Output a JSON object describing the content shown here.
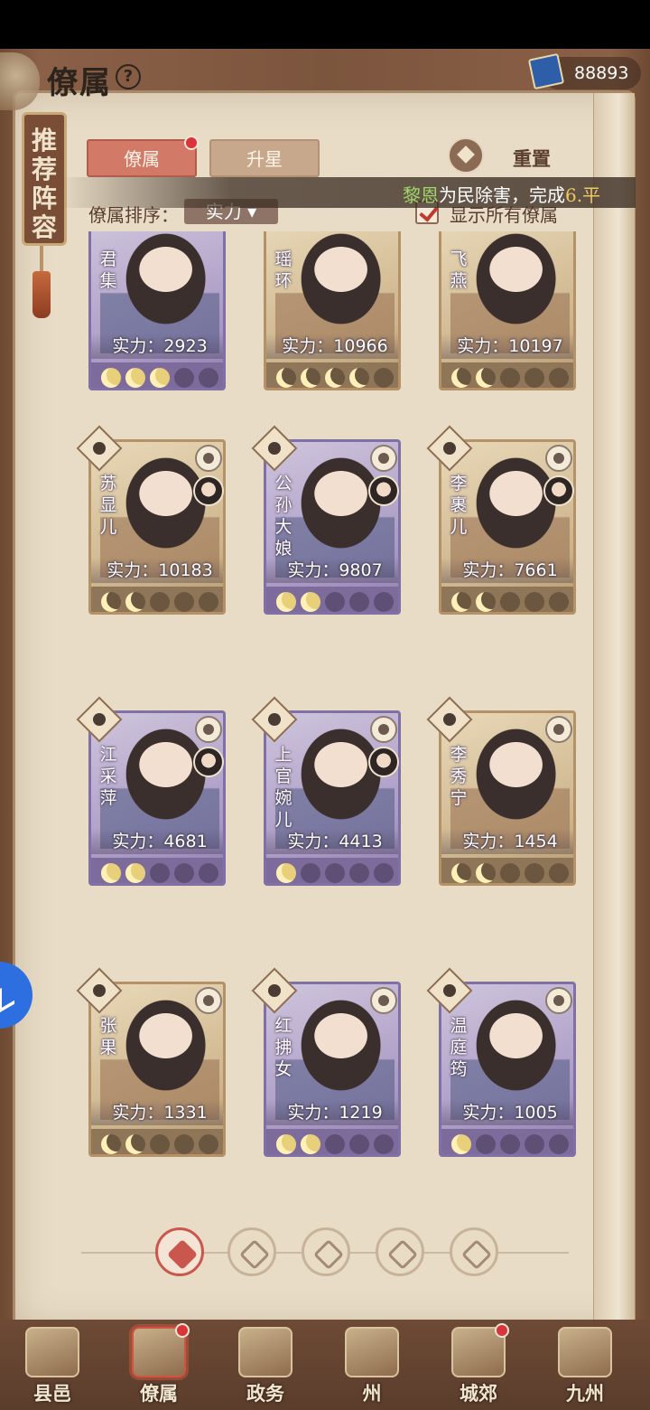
{
  "header": {
    "title": "僚属",
    "currency": {
      "icon": "book-scroll-icon",
      "value": "88893"
    }
  },
  "side_banner": {
    "label": "推荐阵容"
  },
  "tabs": [
    {
      "label": "僚属",
      "active": true,
      "badge": true
    },
    {
      "label": "升星",
      "active": false,
      "badge": false
    }
  ],
  "reset": {
    "label": "重置"
  },
  "announcement": {
    "name": "黎恩",
    "text": "为民除害，完成",
    "suffix": "6.平"
  },
  "sort": {
    "label": "僚属排序：",
    "value": "实力 ▾"
  },
  "show_all": {
    "label": "显示所有僚属",
    "checked": true
  },
  "cards": [
    {
      "name": "君集",
      "power": "实力：2923",
      "stars": 3,
      "theme": "purple"
    },
    {
      "name": "瑶环",
      "power": "实力：10966",
      "stars": 4,
      "theme": "gold"
    },
    {
      "name": "飞燕",
      "power": "实力：10197",
      "stars": 2,
      "theme": "gold"
    },
    {
      "name": "苏显儿",
      "power": "实力：10183",
      "stars": 2,
      "theme": "gold"
    },
    {
      "name": "公孙大娘",
      "power": "实力：9807",
      "stars": 2,
      "theme": "purple"
    },
    {
      "name": "李裹儿",
      "power": "实力：7661",
      "stars": 2,
      "theme": "gold"
    },
    {
      "name": "江采萍",
      "power": "实力：4681",
      "stars": 2,
      "theme": "purple"
    },
    {
      "name": "上官婉儿",
      "power": "实力：4413",
      "stars": 1,
      "theme": "purple"
    },
    {
      "name": "李秀宁",
      "power": "实力：1454",
      "stars": 2,
      "theme": "gold"
    },
    {
      "name": "张果",
      "power": "实力：1331",
      "stars": 2,
      "theme": "gold"
    },
    {
      "name": "红拂女",
      "power": "实力：1219",
      "stars": 2,
      "theme": "purple"
    },
    {
      "name": "温庭筠",
      "power": "实力：1005",
      "stars": 1,
      "theme": "purple"
    }
  ],
  "filters": [
    {
      "icon": "all-diamond-icon",
      "active": true
    },
    {
      "icon": "scholar-hat-icon",
      "active": false
    },
    {
      "icon": "cat-icon",
      "active": false
    },
    {
      "icon": "fan-icon",
      "active": false
    },
    {
      "icon": "horse-icon",
      "active": false
    }
  ],
  "bottom_nav": [
    {
      "label": "县邑",
      "badge": false
    },
    {
      "label": "僚属",
      "badge": true,
      "active": true
    },
    {
      "label": "政务",
      "badge": false
    },
    {
      "label": "州",
      "badge": false
    },
    {
      "label": "城郊",
      "badge": true
    },
    {
      "label": "九州",
      "badge": false
    }
  ]
}
